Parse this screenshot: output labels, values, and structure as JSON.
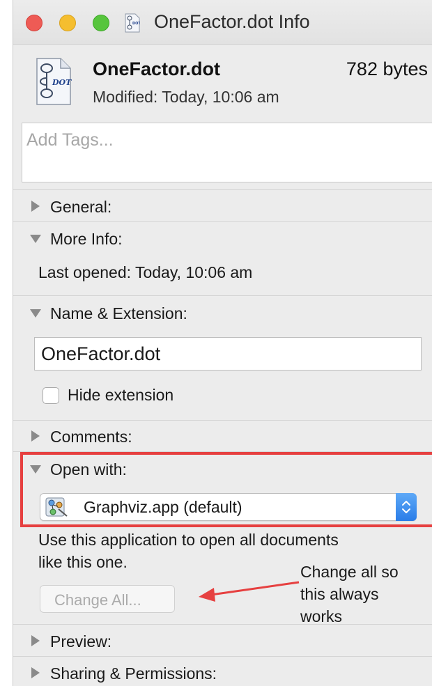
{
  "window": {
    "title": "OneFactor.dot Info"
  },
  "header": {
    "file_name": "OneFactor.dot",
    "file_size": "782 bytes",
    "modified": "Modified: Today, 10:06 am"
  },
  "tags": {
    "placeholder": "Add Tags..."
  },
  "sections": {
    "general": "General:",
    "more_info": "More Info:",
    "last_opened": "Last opened: Today, 10:06 am",
    "name_extension": "Name & Extension:",
    "name_value": "OneFactor.dot",
    "hide_extension": "Hide extension",
    "comments": "Comments:",
    "open_with": "Open with:",
    "open_with_value": "Graphviz.app (default)",
    "open_with_note_line1": "Use this application to open all documents",
    "open_with_note_line2": "like this one.",
    "change_all": "Change All...",
    "preview": "Preview:",
    "sharing": "Sharing & Permissions:"
  },
  "annotation": {
    "line1": "Change all so",
    "line2": "this always",
    "line3": "works"
  },
  "colors": {
    "highlight": "#e64040",
    "arrow": "#e64040",
    "accent": "#2a7de8"
  },
  "icons": {
    "title": "dot-file-icon",
    "file": "dot-file-icon",
    "app": "graphviz-app-icon"
  }
}
